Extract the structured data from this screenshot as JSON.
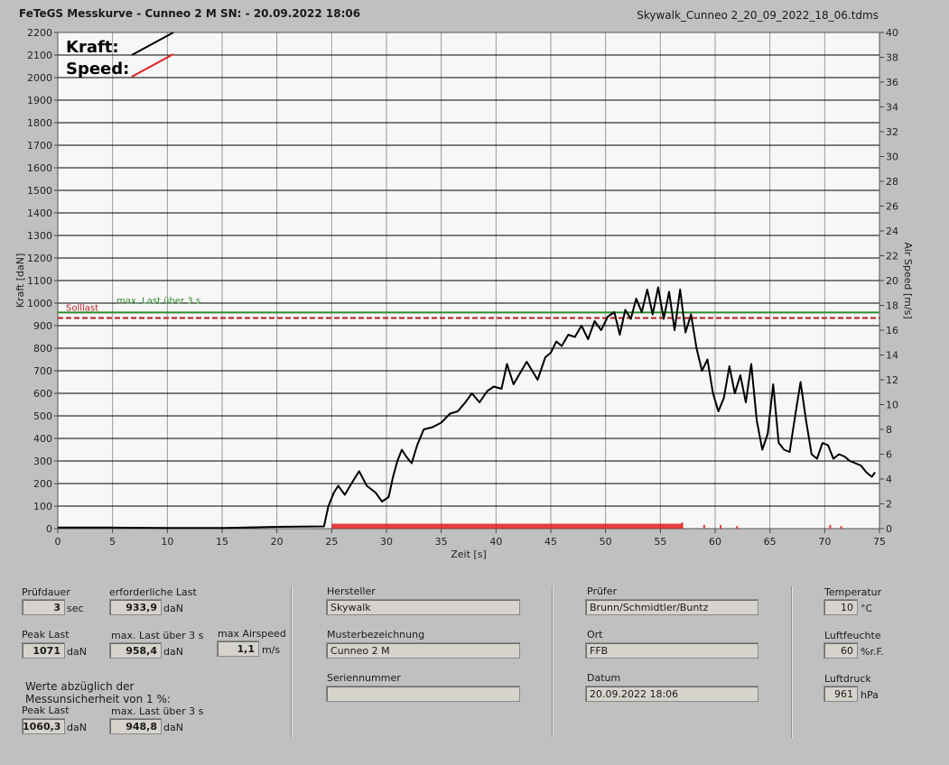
{
  "header": {
    "title": "FeTeGS Messkurve - Cunneo 2 M  SN:  - 20.09.2022 18:06",
    "filename": "Skywalk_Cunneo 2_20_09_2022_18_06.tdms"
  },
  "chart_data": {
    "type": "line",
    "xlabel": "Zeit [s]",
    "ylabel_left": "Kraft [daN]",
    "ylabel_right": "Air Speed [m/s]",
    "xlim": [
      0,
      75
    ],
    "ylim_left": [
      0,
      2200
    ],
    "ylim_right": [
      0,
      40
    ],
    "x_ticks": [
      0,
      5,
      10,
      15,
      20,
      25,
      30,
      35,
      40,
      45,
      50,
      55,
      60,
      65,
      70,
      75
    ],
    "y_left_ticks": [
      0,
      100,
      200,
      300,
      400,
      500,
      600,
      700,
      800,
      900,
      1000,
      1100,
      1200,
      1300,
      1400,
      1500,
      1600,
      1700,
      1800,
      1900,
      2000,
      2100,
      2200
    ],
    "y_right_ticks": [
      0,
      2,
      4,
      6,
      8,
      10,
      12,
      14,
      16,
      18,
      20,
      22,
      24,
      26,
      28,
      30,
      32,
      34,
      36,
      38,
      40
    ],
    "grid": true,
    "legend": [
      {
        "label": "Kraft:",
        "color": "#000000"
      },
      {
        "label": "Speed:",
        "color": "#e02020"
      }
    ],
    "reference_lines": [
      {
        "label": "max. Last über  3 s",
        "value": 958.4,
        "color": "#2e8b2e",
        "style": "solid"
      },
      {
        "label": "Solllast",
        "value": 933.9,
        "color": "#b22222",
        "style": "dashed"
      }
    ],
    "series": [
      {
        "name": "Kraft",
        "color": "#000000",
        "axis": "left",
        "x": [
          0,
          5,
          10,
          15,
          20,
          24.3,
          24.7,
          25.2,
          25.6,
          26.2,
          26.8,
          27.5,
          28.2,
          29,
          29.6,
          30.2,
          30.6,
          31,
          31.4,
          31.8,
          32.3,
          32.8,
          33.4,
          34.2,
          35,
          35.8,
          36.5,
          37.2,
          37.8,
          38.5,
          39.2,
          39.8,
          40.5,
          41,
          41.6,
          42.2,
          42.8,
          43.3,
          43.8,
          44.5,
          45,
          45.5,
          46,
          46.6,
          47.2,
          47.8,
          48.4,
          49,
          49.6,
          50.2,
          50.8,
          51.3,
          51.8,
          52.3,
          52.8,
          53.3,
          53.8,
          54.3,
          54.8,
          55.3,
          55.8,
          56.3,
          56.8,
          57.3,
          57.8,
          58.3,
          58.8,
          59.3,
          59.8,
          60.3,
          60.8,
          61.3,
          61.8,
          62.3,
          62.8,
          63.3,
          63.8,
          64.3,
          64.8,
          65.3,
          65.8,
          66.3,
          66.8,
          67.3,
          67.8,
          68.3,
          68.8,
          69.3,
          69.8,
          70.3,
          70.8,
          71.3,
          71.8,
          72.3,
          72.8,
          73.3,
          73.8,
          74.3,
          74.6
        ],
        "values": [
          5,
          5,
          3,
          3,
          8,
          10,
          100,
          160,
          190,
          150,
          200,
          255,
          190,
          160,
          120,
          140,
          230,
          300,
          350,
          320,
          290,
          370,
          440,
          450,
          470,
          510,
          520,
          560,
          600,
          560,
          610,
          630,
          620,
          730,
          640,
          690,
          740,
          700,
          660,
          760,
          780,
          830,
          810,
          860,
          850,
          900,
          840,
          920,
          880,
          940,
          960,
          860,
          970,
          930,
          1020,
          960,
          1060,
          950,
          1070,
          930,
          1050,
          880,
          1060,
          870,
          950,
          800,
          700,
          750,
          600,
          520,
          580,
          720,
          600,
          680,
          560,
          730,
          480,
          350,
          420,
          640,
          380,
          350,
          340,
          500,
          650,
          480,
          330,
          310,
          380,
          370,
          310,
          330,
          320,
          300,
          290,
          280,
          250,
          230,
          250
        ]
      },
      {
        "name": "Speed",
        "color": "#e02020",
        "axis": "right",
        "x": [
          25,
          57,
          59,
          60.5,
          62,
          70.5,
          71.5
        ],
        "values": [
          0.4,
          0.5,
          0.3,
          0.3,
          0.2,
          0.3,
          0.2
        ]
      }
    ]
  },
  "panel": {
    "pruefdauer": {
      "label": "Prüfdauer",
      "value": "3",
      "unit": "sec"
    },
    "erf_last": {
      "label": "erforderliche Last",
      "value": "933,9",
      "unit": "daN"
    },
    "peak_last": {
      "label": "Peak Last",
      "value": "1071",
      "unit": "daN"
    },
    "max_last": {
      "label": "max. Last über  3 s",
      "value": "958,4",
      "unit": "daN"
    },
    "max_airspeed": {
      "label": "max Airspeed",
      "value": "1,1",
      "unit": "m/s"
    },
    "note": "Werte abzüglich der",
    "note2": "Messunsicherheit von 1  %:",
    "peak_last2": {
      "label": "Peak Last",
      "value": "1060,3",
      "unit": "daN"
    },
    "max_last2": {
      "label": "max. Last über  3 s",
      "value": "948,8",
      "unit": "daN"
    },
    "hersteller": {
      "label": "Hersteller",
      "value": "Skywalk"
    },
    "muster": {
      "label": "Musterbezeichnung",
      "value": "Cunneo 2 M"
    },
    "serie": {
      "label": "Seriennummer",
      "value": ""
    },
    "pruefer": {
      "label": "Prüfer",
      "value": "Brunn/Schmidtler/Buntz"
    },
    "ort": {
      "label": "Ort",
      "value": "FFB"
    },
    "datum": {
      "label": "Datum",
      "value": "20.09.2022 18:06"
    },
    "temperatur": {
      "label": "Temperatur",
      "value": "10",
      "unit": "°C"
    },
    "luftfeuchte": {
      "label": "Luftfeuchte",
      "value": "60",
      "unit": "%r.F."
    },
    "luftdruck": {
      "label": "Luftdruck",
      "value": "961",
      "unit": "hPa"
    }
  }
}
